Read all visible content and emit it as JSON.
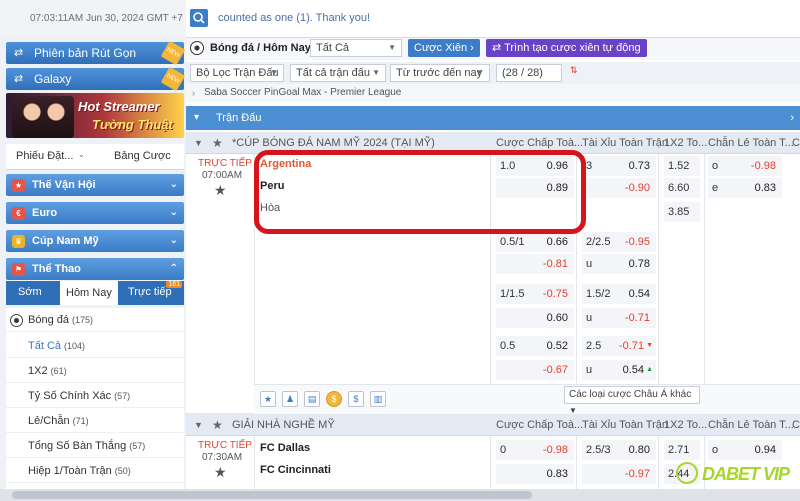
{
  "topbar": {
    "time": "07:03:11AM Jun 30, 2024 GMT +7",
    "message": "counted as one (1). Thank you!"
  },
  "sidebar": {
    "promo1": "Phiên bản Rút Gọn",
    "promo2": "Galaxy",
    "new_badge": "NEW",
    "banner_line1": "Hot Streamer",
    "banner_line2": "Tường Thuật",
    "tab_left": "Phiếu Đặt...",
    "tab_right": "Bảng Cược",
    "sections": [
      "Thế Vận Hội",
      "Euro",
      "Cúp Nam Mỹ",
      "Thể Thao"
    ],
    "subtabs": {
      "early": "Sớm",
      "today": "Hôm Nay",
      "live": "Trực tiếp",
      "live_count": "161"
    },
    "list": [
      {
        "label": "Bóng đá",
        "count": "(175)"
      },
      {
        "label": "Tất Cả",
        "count": "(104)"
      },
      {
        "label": "1X2",
        "count": "(61)"
      },
      {
        "label": "Tỷ Số Chính Xác",
        "count": "(57)"
      },
      {
        "label": "Lẻ/Chẵn",
        "count": "(71)"
      },
      {
        "label": "Tổng Số Bàn Thắng",
        "count": "(57)"
      },
      {
        "label": "Hiệp 1/Toàn Trận",
        "count": "(50)"
      }
    ]
  },
  "main": {
    "title": "Bóng đá / Hôm Nay",
    "select_all": "Tất Cả",
    "btn_parlay": "Cược Xiên",
    "btn_builder": "Trình tạo cược xiên tự động",
    "filter1": "Bộ Lọc Trận Đấu",
    "filter2": "Tất cả trận đấu",
    "filter3": "Từ trước đến nay",
    "filter_count": "(28 / 28) Giải",
    "league_bar": "Saba Soccer PinGoal Max - Premier League",
    "section_bar": "Trận Đấu",
    "col_handicap": "Cược Chấp Toà...",
    "col_ou": "Tài Xỉu Toàn Trận",
    "col_1x2": "1X2 To...",
    "col_oe": "Chẵn Lẻ Toàn T...",
    "col_c": "C",
    "league1": "*CÚP BÓNG ĐÁ NAM MỸ 2024 (TẠI MỸ)",
    "league2": "GIẢI NHÀ NGHỀ MỸ",
    "live_label": "TRỰC TIẾP",
    "match1": {
      "time": "07:00AM",
      "home": "Argentina",
      "away": "Peru",
      "draw": "Hòa",
      "hdp": [
        {
          "h": "1.0",
          "o1": "0.96",
          "o2": "0.89"
        },
        {
          "h": "0.5/1",
          "o1": "0.66",
          "o2": "-0.81"
        },
        {
          "h": "1/1.5",
          "o1": "-0.75",
          "o2": "0.60"
        },
        {
          "h": "0.5",
          "o1": "0.52",
          "o2": "-0.67"
        }
      ],
      "ou": [
        {
          "h": "3",
          "o1": "0.73",
          "u": "",
          "o2": "-0.90"
        },
        {
          "h": "2/2.5",
          "o1": "-0.95",
          "u": "u",
          "o2": "0.78"
        },
        {
          "h": "1.5/2",
          "o1": "0.54",
          "u": "u",
          "o2": "-0.71"
        },
        {
          "h": "2.5",
          "o1": "-0.71",
          "u": "u",
          "o2": "0.54"
        }
      ],
      "x12": [
        "1.52",
        "6.60",
        "3.85"
      ],
      "oe": [
        {
          "l": "o",
          "v": "-0.98"
        },
        {
          "l": "e",
          "v": "0.83"
        }
      ],
      "more": "Các loại cược Châu Á khác"
    },
    "match2": {
      "time": "07:30AM",
      "home": "FC Dallas",
      "away": "FC Cincinnati",
      "hdp": [
        {
          "h": "0",
          "o1": "-0.98",
          "o2": "0.83"
        }
      ],
      "ou": [
        {
          "h": "2.5/3",
          "o1": "0.80",
          "o2": "-0.97"
        }
      ],
      "x12": [
        "2.71",
        "2.44"
      ],
      "oe": [
        {
          "l": "o",
          "v": "0.94"
        }
      ]
    }
  },
  "logo": "DABET VIP",
  "colors": {
    "accent": "#3d7cc9",
    "live": "#e2422f",
    "highlight": "#d8141b",
    "brand": "#a7d62a"
  }
}
